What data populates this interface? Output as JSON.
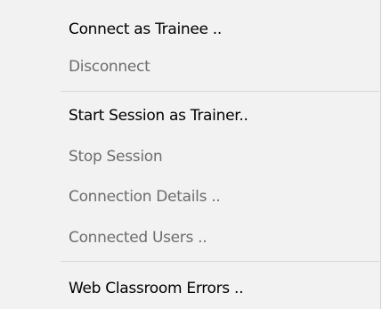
{
  "menu": {
    "items": [
      {
        "label": "Connect as Trainee ..",
        "enabled": true
      },
      {
        "label": "Disconnect",
        "enabled": false
      },
      {
        "label": "Start Session as Trainer..",
        "enabled": true
      },
      {
        "label": "Stop Session",
        "enabled": false
      },
      {
        "label": "Connection Details ..",
        "enabled": false
      },
      {
        "label": "Connected Users ..",
        "enabled": false
      },
      {
        "label": "Web Classroom Errors ..",
        "enabled": true
      }
    ]
  },
  "colors": {
    "menu_background": "#f2f2f2",
    "enabled_text": "#000000",
    "disabled_text": "#6d6d6d",
    "separator": "#d7d7d7"
  }
}
